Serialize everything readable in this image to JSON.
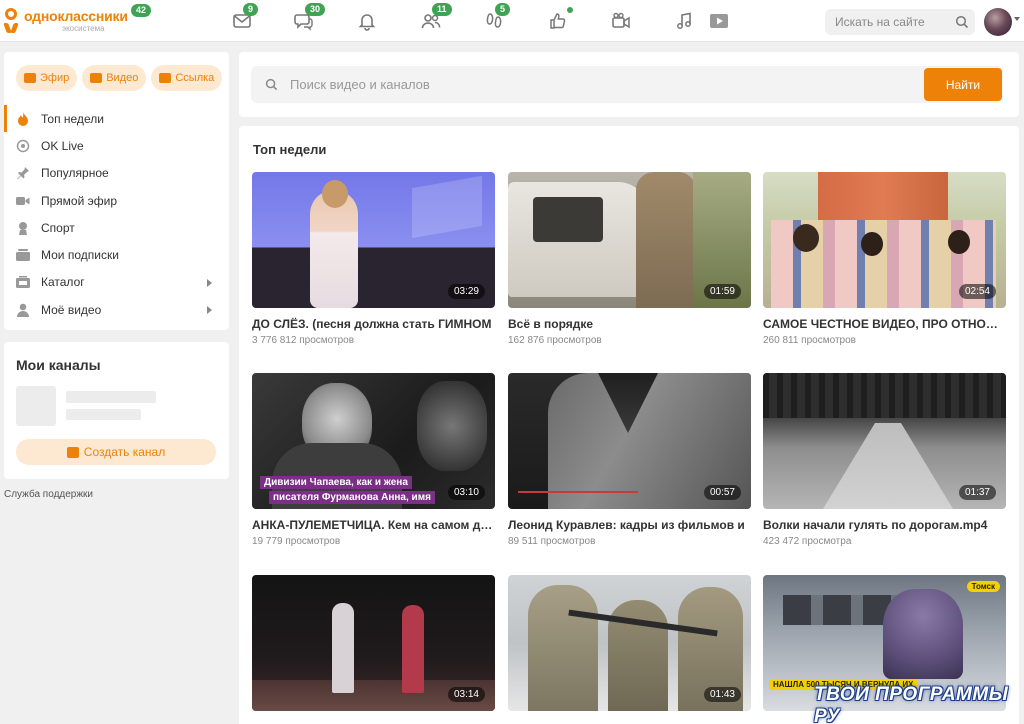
{
  "header": {
    "logo_title": "одноклассники",
    "logo_subtitle": "экосистема",
    "logo_badge": "42",
    "nav": [
      {
        "name": "messages-icon",
        "badge": "9"
      },
      {
        "name": "discussions-icon",
        "badge": "30"
      },
      {
        "name": "notifications-icon",
        "badge": ""
      },
      {
        "name": "friends-icon",
        "badge": "11"
      },
      {
        "name": "guests-icon",
        "badge": "5"
      },
      {
        "name": "events-icon",
        "badge": ""
      },
      {
        "name": "video-icon",
        "badge": ""
      },
      {
        "name": "music-icon",
        "badge": ""
      },
      {
        "name": "play-icon",
        "badge": ""
      }
    ],
    "search_placeholder": "Искать на сайте"
  },
  "sidebar": {
    "pills": [
      "Эфир",
      "Видео",
      "Ссылка"
    ],
    "menu": [
      {
        "label": "Топ недели",
        "icon": "fire-icon",
        "active": true,
        "arrow": false
      },
      {
        "label": "OK Live",
        "icon": "live-icon",
        "active": false,
        "arrow": false
      },
      {
        "label": "Популярное",
        "icon": "pin-icon",
        "active": false,
        "arrow": false
      },
      {
        "label": "Прямой эфир",
        "icon": "camera-icon",
        "active": false,
        "arrow": false
      },
      {
        "label": "Спорт",
        "icon": "sport-icon",
        "active": false,
        "arrow": false
      },
      {
        "label": "Мои подписки",
        "icon": "subscriptions-icon",
        "active": false,
        "arrow": false
      },
      {
        "label": "Каталог",
        "icon": "catalog-icon",
        "active": false,
        "arrow": true
      },
      {
        "label": "Моё видео",
        "icon": "user-icon",
        "active": false,
        "arrow": true
      }
    ],
    "channels_title": "Мои каналы",
    "create_channel": "Создать канал",
    "support": "Служба поддержки"
  },
  "main": {
    "search_placeholder": "Поиск видео и каналов",
    "search_button": "Найти",
    "section_title": "Топ недели",
    "videos": [
      {
        "title": "ДО СЛЁЗ. (песня должна стать ГИМНОМ",
        "views": "3 776 812 просмотров",
        "duration": "03:29"
      },
      {
        "title": "Всё в порядке",
        "views": "162 876 просмотров",
        "duration": "01:59"
      },
      {
        "title": "САМОЕ ЧЕСТНОЕ ВИДЕО, ПРО ОТНОШЕНИЯ",
        "views": "260 811 просмотров",
        "duration": "02:54"
      },
      {
        "title": "АНКА-ПУЛЕМЕТЧИЦА. Кем на самом деле",
        "views": "19 779 просмотров",
        "duration": "03:10",
        "overlay_lines": [
          "Дивизии Чапаева, как и жена",
          "писателя Фурманова Анна, имя"
        ]
      },
      {
        "title": "Леонид Куравлев: кадры из фильмов и",
        "views": "89 511 просмотров",
        "duration": "00:57"
      },
      {
        "title": "Волки начали гулять по дорогам.mp4",
        "views": "423 472 просмотра",
        "duration": "01:37"
      },
      {
        "title": "",
        "views": "",
        "duration": "03:14"
      },
      {
        "title": "",
        "views": "",
        "duration": "01:43"
      },
      {
        "title": "",
        "views": "",
        "duration": "",
        "overlay_lines": [
          "НАШЛА 500 ТЫСЯЧ И ВЕРНУЛА ИХ"
        ],
        "tag": "Томск"
      }
    ]
  },
  "watermark": "ТВОИ ПРОГРАММЫ РУ",
  "colors": {
    "accent": "#ee8208",
    "badge": "#3fa354"
  }
}
